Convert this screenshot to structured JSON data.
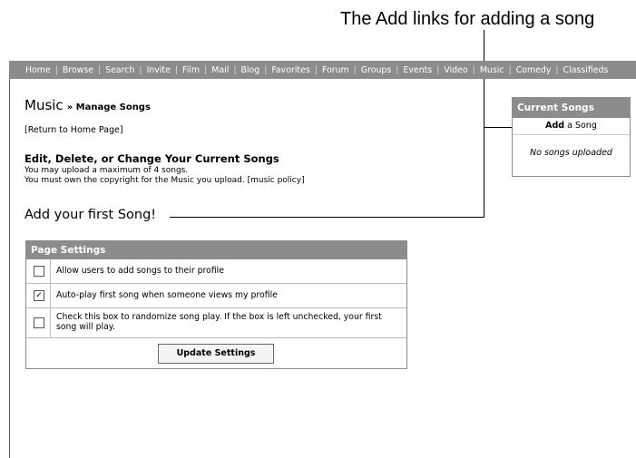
{
  "annotation": {
    "caption": "The Add links for adding a song"
  },
  "nav": {
    "items": [
      "Home",
      "Browse",
      "Search",
      "Invite",
      "Film",
      "Mail",
      "Blog",
      "Favorites",
      "Forum",
      "Groups",
      "Events",
      "Video",
      "Music",
      "Comedy",
      "Classifieds"
    ],
    "separator": "|"
  },
  "page": {
    "title": "Music",
    "subtitle": "» Manage Songs",
    "return_link": "[Return to Home Page]",
    "section_heading": "Edit, Delete, or Change Your Current Songs",
    "info_line1": "You may upload a maximum of 4 songs.",
    "info_line2_prefix": "You must own the copyright for the Music you upload.",
    "info_line2_link": "[music policy]",
    "add_first": "Add your first Song!"
  },
  "current_songs": {
    "header": "Current Songs",
    "add_bold": "Add",
    "add_rest": "a Song",
    "empty": "No songs uploaded"
  },
  "settings": {
    "header": "Page Settings",
    "options": [
      {
        "label": "Allow users to add songs to their profile",
        "checked": false,
        "check_glyph": ""
      },
      {
        "label": "Auto-play first song when someone views my profile",
        "checked": true,
        "check_glyph": "✓"
      },
      {
        "label": "Check this box to randomize song play. If the box is left unchecked, your first song will play.",
        "checked": false,
        "check_glyph": ""
      }
    ],
    "button": "Update Settings"
  },
  "colors": {
    "header_bg": "#8c8c8c",
    "border": "#bdbdbd"
  }
}
